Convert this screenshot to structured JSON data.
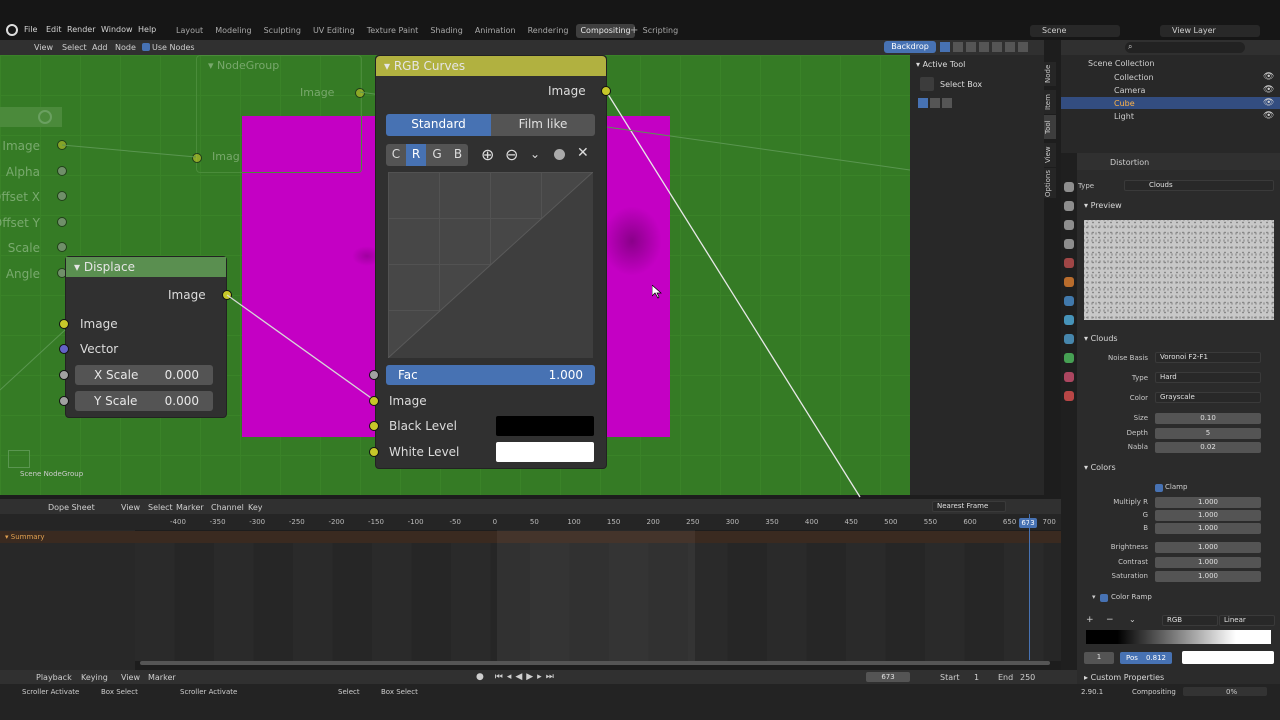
{
  "menu": {
    "file": "File",
    "edit": "Edit",
    "render": "Render",
    "window": "Window",
    "help": "Help"
  },
  "workspaces": [
    "Layout",
    "Modeling",
    "Sculpting",
    "UV Editing",
    "Texture Paint",
    "Shading",
    "Animation",
    "Rendering",
    "Compositing",
    "Scripting"
  ],
  "active_workspace": "Compositing",
  "scene": "Scene",
  "view_layer": "View Layer",
  "node_header": {
    "view": "View",
    "select": "Select",
    "add": "Add",
    "node": "Node",
    "use_nodes": "Use Nodes",
    "backdrop": "Backdrop"
  },
  "active_tool": {
    "title": "Active Tool",
    "tool": "Select Box"
  },
  "side_tabs": [
    "Node",
    "Item",
    "Tool",
    "View",
    "Options"
  ],
  "nodes": {
    "nodegroup": {
      "title": "NodeGroup",
      "image": "Image",
      "image2": "Imag",
      "label": "Scene NodeGroup"
    },
    "left_sockets": [
      "Image",
      "Alpha",
      "Offset X",
      "Offset Y",
      "Scale",
      "Angle"
    ],
    "displace": {
      "title": "Displace",
      "out_image": "Image",
      "in_image": "Image",
      "vector": "Vector",
      "xscale_label": "X Scale",
      "xscale_val": "0.000",
      "yscale_label": "Y Scale",
      "yscale_val": "0.000"
    },
    "rgbcurves": {
      "title": "RGB Curves",
      "out_image": "Image",
      "standard": "Standard",
      "filmlike": "Film like",
      "channels": [
        "C",
        "R",
        "G",
        "B"
      ],
      "fac_label": "Fac",
      "fac_val": "1.000",
      "in_image": "Image",
      "black": "Black Level",
      "white": "White Level"
    }
  },
  "outliner": {
    "scene_collection": "Scene Collection",
    "collection": "Collection",
    "items": [
      "Camera",
      "Cube",
      "Light"
    ]
  },
  "properties": {
    "title": "Distortion",
    "type_label": "Type",
    "type_val": "Clouds",
    "preview": "Preview",
    "clouds": "Clouds",
    "noise_basis_label": "Noise Basis",
    "noise_basis": "Voronoi F2-F1",
    "ntype_label": "Type",
    "ntype": "Hard",
    "color_label": "Color",
    "color": "Grayscale",
    "size_label": "Size",
    "size": "0.10",
    "depth_label": "Depth",
    "depth": "5",
    "nabla_label": "Nabla",
    "nabla": "0.02",
    "colors": "Colors",
    "clamp": "Clamp",
    "mr_label": "Multiply R",
    "mr": "1.000",
    "g_label": "G",
    "g": "1.000",
    "b_label": "B",
    "b": "1.000",
    "bright_label": "Brightness",
    "bright": "1.000",
    "contrast_label": "Contrast",
    "contrast": "1.000",
    "sat_label": "Saturation",
    "sat": "1.000",
    "colorramp": "Color Ramp",
    "ramp_mode": "RGB",
    "ramp_interp": "Linear",
    "ramp_idx": "1",
    "pos_label": "Pos",
    "pos": "0.812",
    "custom": "Custom Properties"
  },
  "dopesheet": {
    "mode": "Dope Sheet",
    "view": "View",
    "select": "Select",
    "marker": "Marker",
    "channel": "Channel",
    "key": "Key",
    "snap": "Nearest Frame",
    "summary": "Summary",
    "ticks": [
      "-400",
      "-350",
      "-300",
      "-250",
      "-200",
      "-150",
      "-100",
      "-50",
      "0",
      "50",
      "100",
      "150",
      "200",
      "250",
      "300",
      "350",
      "400",
      "450",
      "500",
      "550",
      "600",
      "650",
      "700"
    ],
    "current": "673"
  },
  "timeline": {
    "playback": "Playback",
    "keying": "Keying",
    "view": "View",
    "marker": "Marker",
    "frame": "673",
    "start_label": "Start",
    "start": "1",
    "end_label": "End",
    "end": "250"
  },
  "status": {
    "a": "Scroller Activate",
    "b": "Box Select",
    "c": "Scroller Activate",
    "d": "Select",
    "e": "Box Select",
    "version": "2.90.1",
    "workspace": "Compositing",
    "progress": "0%"
  },
  "colors": {
    "magenta": "#c400c4",
    "node_green": "#357b25",
    "accent": "#4772b3",
    "socket_yellow": "#c7c729"
  }
}
